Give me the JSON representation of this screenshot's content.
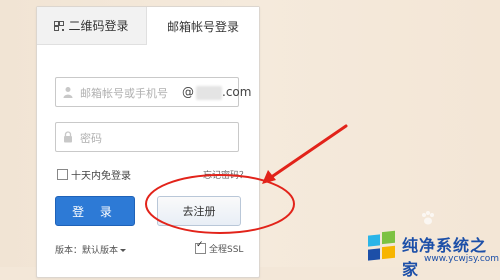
{
  "tabs": {
    "qr": "二维码登录",
    "email": "邮箱帐号登录"
  },
  "form": {
    "username_placeholder": "邮箱帐号或手机号",
    "domain_at": "@",
    "domain_suffix": ".com",
    "password_placeholder": "密码",
    "remember_label": "十天内免登录",
    "forgot_label": "忘记密码？",
    "login_button": "登 录",
    "register_button": "去注册",
    "version_label": "版本：默认版本",
    "ssl_label": "全程SSL"
  },
  "watermark": {
    "name": "纯净系统之家",
    "url": "www.ycwjsy.com"
  },
  "colors": {
    "accent": "#2d7ad6",
    "annotation": "#e2231a",
    "brand": "#1c4fa8"
  }
}
